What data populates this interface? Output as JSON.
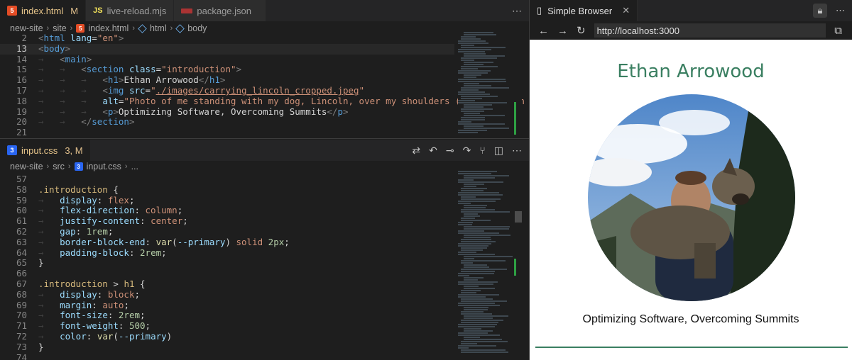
{
  "editor_top": {
    "tabs": [
      {
        "label": "index.html",
        "badge": "M",
        "icon": "html5-icon",
        "active": true
      },
      {
        "label": "live-reload.mjs",
        "badge": "",
        "icon": "js-icon",
        "active": false
      },
      {
        "label": "package.json",
        "badge": "",
        "icon": "npm-icon",
        "active": false
      }
    ],
    "more_icon": "ellipsis-icon",
    "breadcrumb": [
      "new-site",
      "site",
      "index.html",
      "html",
      "body"
    ],
    "lines": [
      {
        "n": "2",
        "html": "<span class='tk-punct'>&lt;</span><span class='tk-tag'>html</span> <span class='tk-attr'>lang</span><span class='tk-plain'>=</span><span class='tk-str'>\"en\"</span><span class='tk-punct'>&gt;</span>"
      },
      {
        "n": "13",
        "html": "<span class='tk-punct'>&lt;</span><span class='tk-tag'>body</span><span class='tk-punct'>&gt;</span>",
        "current": true
      },
      {
        "n": "14",
        "html": "<span class='tk-guide'>→   </span><span class='tk-punct'>&lt;</span><span class='tk-tag'>main</span><span class='tk-punct'>&gt;</span>"
      },
      {
        "n": "15",
        "html": "<span class='tk-guide'>→   →   </span><span class='tk-punct'>&lt;</span><span class='tk-tag'>section</span> <span class='tk-attr'>class</span><span class='tk-plain'>=</span><span class='tk-str'>\"introduction\"</span><span class='tk-punct'>&gt;</span>"
      },
      {
        "n": "16",
        "html": "<span class='tk-guide'>→   →   →   </span><span class='tk-punct'>&lt;</span><span class='tk-tag'>h1</span><span class='tk-punct'>&gt;</span><span class='tk-plain'>Ethan Arrowood</span><span class='tk-punct'>&lt;/</span><span class='tk-tag'>h1</span><span class='tk-punct'>&gt;</span>"
      },
      {
        "n": "17",
        "html": "<span class='tk-guide'>→   →   →   </span><span class='tk-punct'>&lt;</span><span class='tk-tag'>img</span> <span class='tk-attr'>src</span><span class='tk-plain'>=</span><span class='tk-str'>\"<u>./images/carrying_lincoln_cropped.jpeg</u>\"</span>"
      },
      {
        "n": "18",
        "html": "<span class='tk-guide'>→   →   →   </span><span class='tk-attr'>alt</span><span class='tk-plain'>=</span><span class='tk-str'>\"Photo of me standing with my dog, Lincoln, over my shoulders (in a fireman carry). T</span>"
      },
      {
        "n": "19",
        "html": "<span class='tk-guide'>→   →   →   </span><span class='tk-punct'>&lt;</span><span class='tk-tag'>p</span><span class='tk-punct'>&gt;</span><span class='tk-plain'>Optimizing Software, Overcoming Summits</span><span class='tk-punct'>&lt;/</span><span class='tk-tag'>p</span><span class='tk-punct'>&gt;</span>"
      },
      {
        "n": "20",
        "html": "<span class='tk-guide'>→   →   </span><span class='tk-punct'>&lt;/</span><span class='tk-tag'>section</span><span class='tk-punct'>&gt;</span>"
      },
      {
        "n": "21",
        "html": ""
      }
    ]
  },
  "editor_bottom": {
    "tab": {
      "label": "input.css",
      "badge": "3, M",
      "icon": "css3-icon"
    },
    "breadcrumb": [
      "new-site",
      "src",
      "input.css",
      "..."
    ],
    "lines": [
      {
        "n": "57",
        "html": ""
      },
      {
        "n": "58",
        "html": "<span class='tk-sel'>.introduction</span> <span class='tk-plain'>{</span>"
      },
      {
        "n": "59",
        "html": "<span class='tk-guide'>→   </span><span class='tk-prop'>display</span><span class='tk-plain'>: </span><span class='tk-str'>flex</span><span class='tk-plain'>;</span>"
      },
      {
        "n": "60",
        "html": "<span class='tk-guide'>→   </span><span class='tk-prop'>flex-direction</span><span class='tk-plain'>: </span><span class='tk-str'>column</span><span class='tk-plain'>;</span>"
      },
      {
        "n": "61",
        "html": "<span class='tk-guide'>→   </span><span class='tk-prop'>justify-content</span><span class='tk-plain'>: </span><span class='tk-str'>center</span><span class='tk-plain'>;</span>"
      },
      {
        "n": "62",
        "html": "<span class='tk-guide'>→   </span><span class='tk-prop'>gap</span><span class='tk-plain'>: </span><span class='tk-num'>1rem</span><span class='tk-plain'>;</span>"
      },
      {
        "n": "63",
        "html": "<span class='tk-guide'>→   </span><span class='tk-prop'>border-block-end</span><span class='tk-plain'>: </span><span class='tk-fn'>var</span><span class='tk-plain'>(</span><span class='tk-prop'>--primary</span><span class='tk-plain'>) </span><span class='tk-str'>solid</span> <span class='tk-num'>2px</span><span class='tk-plain'>;</span>"
      },
      {
        "n": "64",
        "html": "<span class='tk-guide'>→   </span><span class='tk-prop'>padding-block</span><span class='tk-plain'>: </span><span class='tk-num'>2rem</span><span class='tk-plain'>;</span>"
      },
      {
        "n": "65",
        "html": "<span class='tk-plain'>}</span>"
      },
      {
        "n": "66",
        "html": ""
      },
      {
        "n": "67",
        "html": "<span class='tk-sel'>.introduction</span> <span class='tk-plain'>&gt;</span> <span class='tk-sel'>h1</span> <span class='tk-plain'>{</span>"
      },
      {
        "n": "68",
        "html": "<span class='tk-guide'>→   </span><span class='tk-prop'>display</span><span class='tk-plain'>: </span><span class='tk-str'>block</span><span class='tk-plain'>;</span>"
      },
      {
        "n": "69",
        "html": "<span class='tk-guide'>→   </span><span class='tk-prop'>margin</span><span class='tk-plain'>: </span><span class='tk-str'>auto</span><span class='tk-plain'>;</span>"
      },
      {
        "n": "70",
        "html": "<span class='tk-guide'>→   </span><span class='tk-prop'>font-size</span><span class='tk-plain'>: </span><span class='tk-num'>2rem</span><span class='tk-plain'>;</span>"
      },
      {
        "n": "71",
        "html": "<span class='tk-guide'>→   </span><span class='tk-prop'>font-weight</span><span class='tk-plain'>: </span><span class='tk-num'>500</span><span class='tk-plain'>;</span>"
      },
      {
        "n": "72",
        "html": "<span class='tk-guide'>→   </span><span class='tk-prop'>color</span><span class='tk-plain'>: </span><span class='tk-fn'>var</span><span class='tk-plain'>(</span><span class='tk-prop'>--primary</span><span class='tk-plain'>)</span>"
      },
      {
        "n": "73",
        "html": "<span class='tk-plain'>}</span>"
      },
      {
        "n": "74",
        "html": ""
      }
    ]
  },
  "browser": {
    "tab_label": "Simple Browser",
    "url": "http://localhost:3000",
    "page": {
      "title": "Ethan Arrowood",
      "subtitle": "Optimizing Software, Overcoming Summits",
      "image_alt": "Photo of me standing with my dog, Lincoln, over my shoulders (in a fireman carry).",
      "primary_color": "#3a7f61"
    }
  },
  "colors": {
    "editor_bg": "#1e1e1e",
    "modified_badge": "#e2c08d",
    "primary": "#3a7f61"
  }
}
